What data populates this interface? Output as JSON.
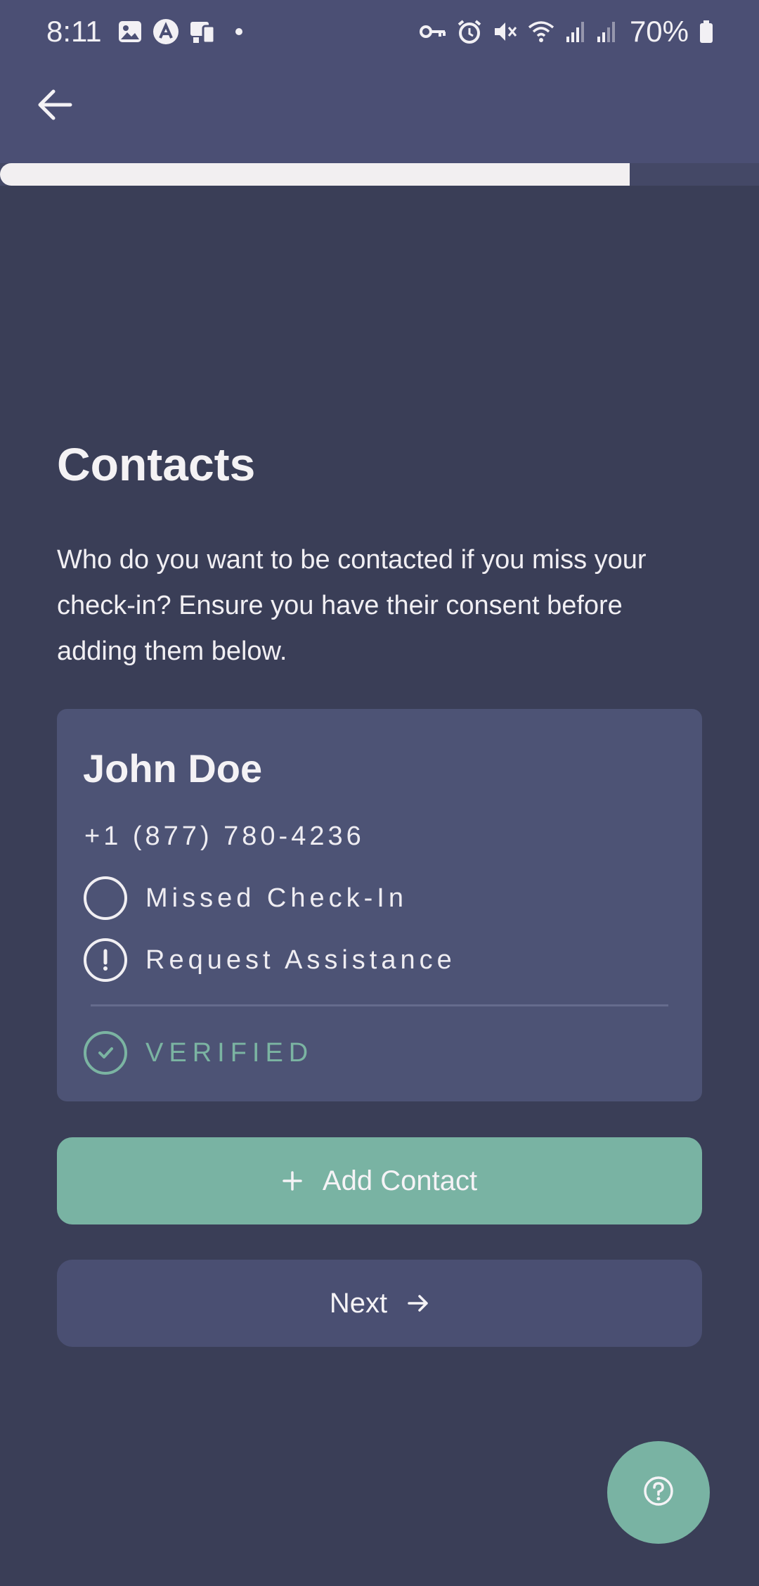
{
  "status_bar": {
    "time": "8:11",
    "battery_percent": "70%",
    "left_icons": [
      "gallery-icon",
      "a-badge-icon",
      "devices-icon",
      "dot-icon"
    ],
    "right_icons": [
      "key-icon",
      "alarm-icon",
      "mute-icon",
      "wifi-icon",
      "signal-icon",
      "signal-icon-2",
      "battery-icon"
    ]
  },
  "header": {
    "back_icon": "arrow-left-icon",
    "progress": 0.83
  },
  "main": {
    "title": "Contacts",
    "description": "Who do you want to be contacted if you miss your check-in? Ensure you have their consent before adding them below."
  },
  "contact": {
    "name": "John Doe",
    "phone": "+1 (877) 780-4236",
    "options": [
      {
        "label": "Missed Check-In",
        "icon": "circle-icon",
        "checked": false
      },
      {
        "label": "Request Assistance",
        "icon": "alert-circle-icon",
        "checked": false
      }
    ],
    "status": "VERIFIED",
    "status_icon": "check-circle-icon"
  },
  "actions": {
    "add_contact_label": "Add Contact",
    "next_label": "Next",
    "help_icon": "help-circle-icon"
  },
  "colors": {
    "background": "#3a3e57",
    "header": "#4b4f74",
    "card": "#4d5375",
    "accent": "#79b3a3",
    "next_button": "#4a4f72"
  }
}
